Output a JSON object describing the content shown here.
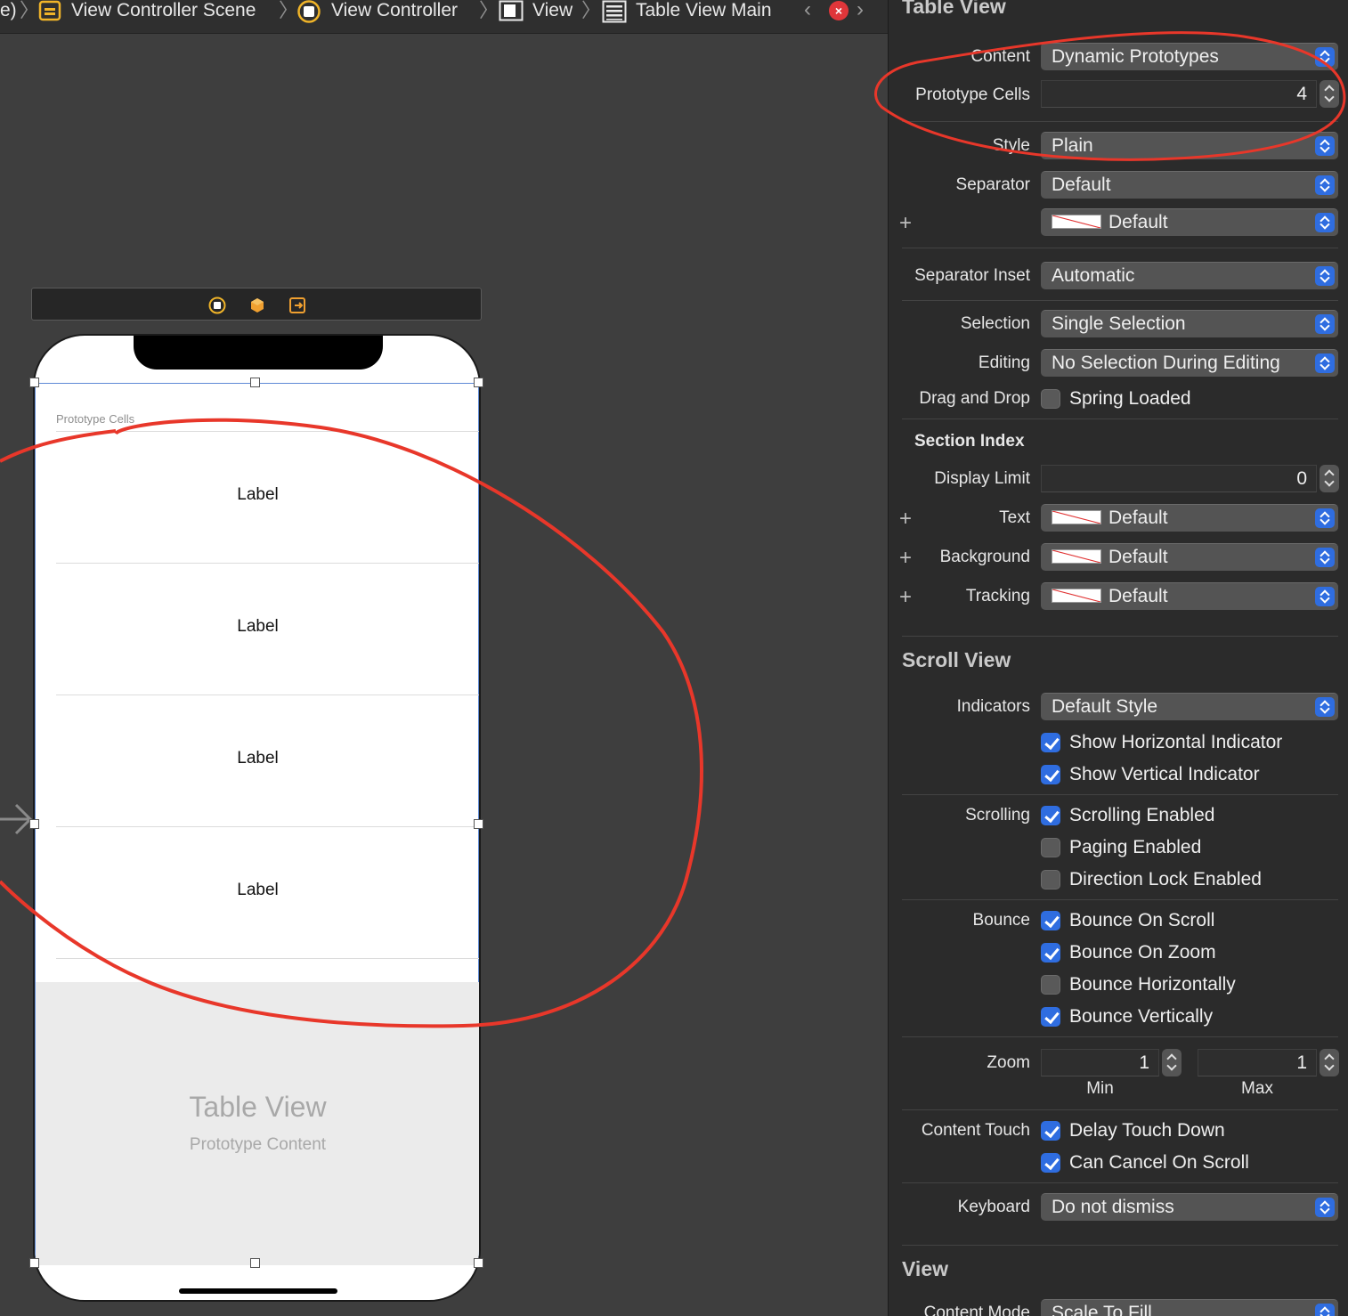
{
  "breadcrumb": {
    "lead": "e)",
    "items": [
      {
        "label": "View Controller Scene",
        "icon": "scene-icon"
      },
      {
        "label": "View Controller",
        "icon": "view-controller-icon"
      },
      {
        "label": "View",
        "icon": "view-icon"
      },
      {
        "label": "Table View Main",
        "icon": "table-view-icon"
      }
    ],
    "prev": "‹",
    "next": "›",
    "error": "×"
  },
  "canvas": {
    "dock_icons": [
      "view-controller-icon",
      "first-responder-icon",
      "exit-icon"
    ],
    "section_header": "Prototype Cells",
    "cells": [
      "Label",
      "Label",
      "Label",
      "Label"
    ],
    "placeholder_title": "Table View",
    "placeholder_subtitle": "Prototype Content"
  },
  "inspector": {
    "table_view": {
      "title": "Table View",
      "content_label": "Content",
      "content_value": "Dynamic Prototypes",
      "prototype_cells_label": "Prototype Cells",
      "prototype_cells_value": "4",
      "style_label": "Style",
      "style_value": "Plain",
      "separator_label": "Separator",
      "separator_value": "Default",
      "separator_color_value": "Default",
      "separator_inset_label": "Separator Inset",
      "separator_inset_value": "Automatic",
      "selection_label": "Selection",
      "selection_value": "Single Selection",
      "editing_label": "Editing",
      "editing_value": "No Selection During Editing",
      "drag_drop_label": "Drag and Drop",
      "spring_loaded": "Spring Loaded",
      "spring_loaded_checked": false,
      "section_index_title": "Section Index",
      "display_limit_label": "Display Limit",
      "display_limit_value": "0",
      "text_label": "Text",
      "text_value": "Default",
      "background_label": "Background",
      "background_value": "Default",
      "tracking_label": "Tracking",
      "tracking_value": "Default"
    },
    "scroll_view": {
      "title": "Scroll View",
      "indicators_label": "Indicators",
      "indicators_value": "Default Style",
      "show_horizontal": "Show Horizontal Indicator",
      "show_vertical": "Show Vertical Indicator",
      "scrolling_label": "Scrolling",
      "scrolling_enabled": "Scrolling Enabled",
      "paging_enabled": "Paging Enabled",
      "direction_lock": "Direction Lock Enabled",
      "bounce_label": "Bounce",
      "bounce_on_scroll": "Bounce On Scroll",
      "bounce_on_zoom": "Bounce On Zoom",
      "bounce_horizontally": "Bounce Horizontally",
      "bounce_vertically": "Bounce Vertically",
      "zoom_label": "Zoom",
      "zoom_min": "1",
      "zoom_max": "1",
      "min_caption": "Min",
      "max_caption": "Max",
      "content_touch_label": "Content Touch",
      "delay_touch_down": "Delay Touch Down",
      "can_cancel_on_scroll": "Can Cancel On Scroll",
      "keyboard_label": "Keyboard",
      "keyboard_value": "Do not dismiss",
      "checks": {
        "show_horizontal": true,
        "show_vertical": true,
        "scrolling_enabled": true,
        "paging_enabled": false,
        "direction_lock": false,
        "bounce_on_scroll": true,
        "bounce_on_zoom": true,
        "bounce_horizontally": false,
        "bounce_vertically": true,
        "delay_touch_down": true,
        "can_cancel_on_scroll": true
      }
    },
    "view": {
      "title": "View",
      "content_mode_label": "Content Mode",
      "content_mode_value": "Scale To Fill"
    }
  },
  "colors": {
    "accent": "#2f6de0",
    "annotation": "#e8372a",
    "selection_outline": "#5e8ad6"
  }
}
